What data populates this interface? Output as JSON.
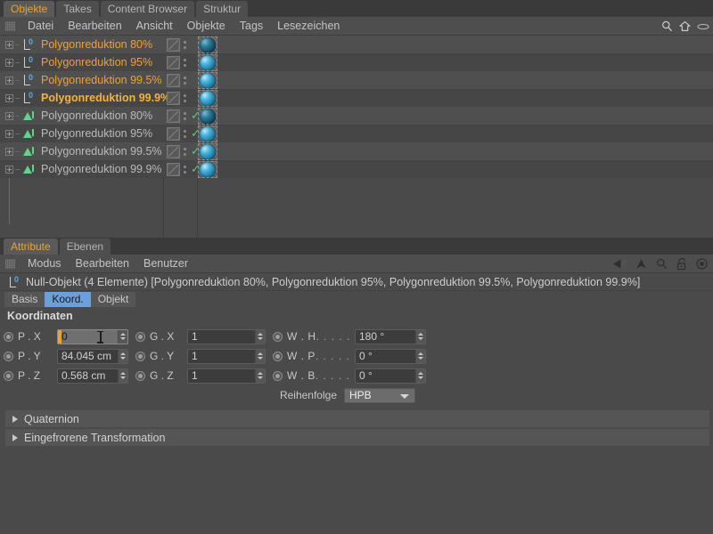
{
  "object_manager": {
    "tabs": [
      {
        "label": "Objekte",
        "active": true
      },
      {
        "label": "Takes",
        "active": false
      },
      {
        "label": "Content Browser",
        "active": false
      },
      {
        "label": "Struktur",
        "active": false
      }
    ],
    "menu": [
      "Datei",
      "Bearbeiten",
      "Ansicht",
      "Objekte",
      "Tags",
      "Lesezeichen"
    ],
    "menu_icons": [
      "search-icon",
      "home-icon",
      "eye-icon"
    ],
    "rows": [
      {
        "name": "Polygonreduktion 80%",
        "icon": "null-object-icon",
        "color": "orange",
        "has_check": false,
        "material_dark": true
      },
      {
        "name": "Polygonreduktion 95%",
        "icon": "null-object-icon",
        "color": "orange",
        "has_check": false,
        "material_dark": false
      },
      {
        "name": "Polygonreduktion 99.5%",
        "icon": "null-object-icon",
        "color": "orange",
        "has_check": false,
        "material_dark": false
      },
      {
        "name": "Polygonreduktion 99.9%",
        "icon": "null-object-icon",
        "color": "orange-bold",
        "has_check": false,
        "material_dark": false
      },
      {
        "name": "Polygonreduktion 80%",
        "icon": "polygon-reduction-icon",
        "color": "grey",
        "has_check": true,
        "material_dark": true
      },
      {
        "name": "Polygonreduktion 95%",
        "icon": "polygon-reduction-icon",
        "color": "grey",
        "has_check": true,
        "material_dark": false
      },
      {
        "name": "Polygonreduktion 99.5%",
        "icon": "polygon-reduction-icon",
        "color": "grey",
        "has_check": true,
        "material_dark": false
      },
      {
        "name": "Polygonreduktion 99.9%",
        "icon": "polygon-reduction-icon",
        "color": "grey",
        "has_check": true,
        "material_dark": false
      }
    ]
  },
  "attribute_manager": {
    "tabs": [
      {
        "label": "Attribute",
        "active": true
      },
      {
        "label": "Ebenen",
        "active": false
      }
    ],
    "menu": [
      "Modus",
      "Bearbeiten",
      "Benutzer"
    ],
    "toolbar_icons": [
      "back-arrow-icon",
      "forward-arrow-icon",
      "up-arrow-icon",
      "search-icon",
      "lock-icon",
      "target-icon"
    ],
    "object_title": "Null-Objekt (4 Elemente) [Polygonreduktion 80%, Polygonreduktion 95%, Polygonreduktion 99.5%, Polygonreduktion 99.9%]",
    "object_icon": "null-object-icon",
    "mode_tabs": [
      {
        "label": "Basis",
        "active": false
      },
      {
        "label": "Koord.",
        "active": true
      },
      {
        "label": "Objekt",
        "active": false
      }
    ],
    "coordinates": {
      "section_title": "Koordinaten",
      "position": [
        {
          "label": "P . X",
          "value": "0",
          "editing": true
        },
        {
          "label": "P . Y",
          "value": "84.045 cm",
          "editing": false
        },
        {
          "label": "P . Z",
          "value": "0.568 cm",
          "editing": false
        }
      ],
      "scale": [
        {
          "label": "G . X",
          "value": "1"
        },
        {
          "label": "G . Y",
          "value": "1"
        },
        {
          "label": "G . Z",
          "value": "1"
        }
      ],
      "rotation": [
        {
          "label": "W . H",
          "dots": ". . . . . .",
          "value": "180 °"
        },
        {
          "label": "W . P",
          "dots": ". . . . . .",
          "value": "0 °"
        },
        {
          "label": "W . B",
          "dots": ". . . . . .",
          "value": "0 °"
        }
      ],
      "order_label": "Reihenfolge",
      "order_value": "HPB"
    },
    "fold_sections": [
      {
        "label": "Quaternion"
      },
      {
        "label": "Eingefrorene Transformation"
      }
    ]
  },
  "colors": {
    "accent_orange": "#f0a030",
    "tab_blue": "#6d9fd8",
    "check_green": "#55cc77",
    "panel_bg": "#4a4a4a",
    "row_alt": "#464646"
  }
}
